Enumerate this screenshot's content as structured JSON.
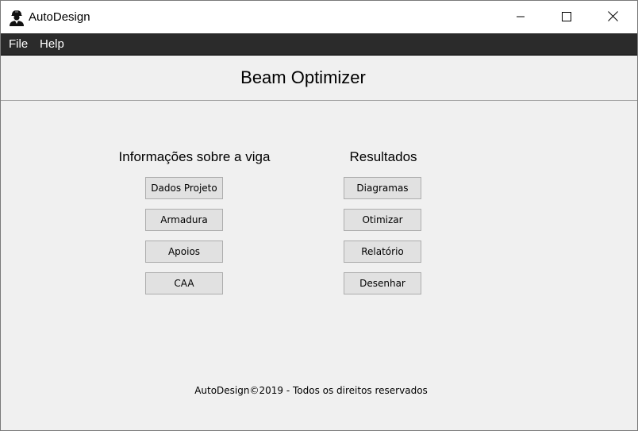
{
  "window": {
    "title": "AutoDesign",
    "icon": "engineer-avatar-icon",
    "controls": [
      "minimize-icon",
      "maximize-icon",
      "close-icon"
    ]
  },
  "menubar": {
    "items": [
      {
        "label": "File"
      },
      {
        "label": "Help"
      }
    ]
  },
  "header": {
    "title": "Beam Optimizer"
  },
  "left_section": {
    "title": "Informações sobre a viga",
    "buttons": [
      {
        "label": "Dados Projeto"
      },
      {
        "label": "Armadura"
      },
      {
        "label": "Apoios"
      },
      {
        "label": "CAA"
      }
    ]
  },
  "right_section": {
    "title": "Resultados",
    "buttons": [
      {
        "label": "Diagramas"
      },
      {
        "label": "Otimizar"
      },
      {
        "label": "Relatório"
      },
      {
        "label": "Desenhar"
      }
    ]
  },
  "footer": {
    "text": "AutoDesign©2019 - Todos os direitos reservados"
  },
  "colors": {
    "menubar_bg": "#2b2b2b",
    "window_bg": "#f0f0f0",
    "button_bg": "#e1e1e1",
    "button_border": "#adadad"
  }
}
